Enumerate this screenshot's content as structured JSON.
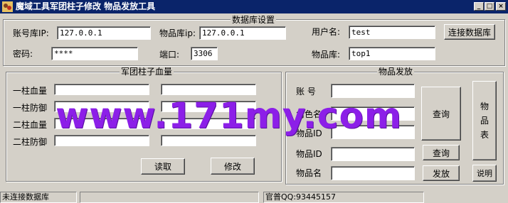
{
  "window": {
    "title": "魔域工具军团柱子修改 物品发放工具",
    "controls": {
      "minimize": "_",
      "maximize": "□",
      "close": "×"
    }
  },
  "db_settings": {
    "title": "数据库设置",
    "ip_label": "账号库IP:",
    "ip_value": "127.0.0.1",
    "item_ip_label": "物品库ip:",
    "item_ip_value": "127.0.0.1",
    "user_label": "用户名:",
    "user_value": "test",
    "password_label": "密码:",
    "password_value": "****",
    "port_label": "端口:",
    "port_value": "3306",
    "item_db_label": "物品库:",
    "item_db_value": "top1",
    "connect_button": "连接数据库"
  },
  "legion": {
    "title": "军团柱子血量",
    "rows": [
      {
        "label": "一柱血量",
        "value1": "",
        "value2": ""
      },
      {
        "label": "一柱防御",
        "value1": "",
        "value2": ""
      },
      {
        "label": "二柱血量",
        "value1": "",
        "value2": ""
      },
      {
        "label": "二柱防御",
        "value1": "",
        "value2": ""
      }
    ],
    "read_button": "读取",
    "modify_button": "修改"
  },
  "items": {
    "title": "物品发放",
    "account_label": "账  号",
    "account_value": "",
    "role_label_partial": "角色名",
    "role_value": "",
    "item_label_partial": "物品ID",
    "item_value": "",
    "query_button": "查询",
    "item_id_label": "物品ID",
    "item_id_value": "",
    "item_name_label": "物品名",
    "item_name_value": "",
    "query2_button": "查询",
    "give_button": "发放",
    "item_table_button": "物品表",
    "help_button": "说明"
  },
  "watermark": "www.171my.com",
  "status": {
    "left": "未连接数据库",
    "middle": "",
    "right": "官普QQ:93445157"
  }
}
